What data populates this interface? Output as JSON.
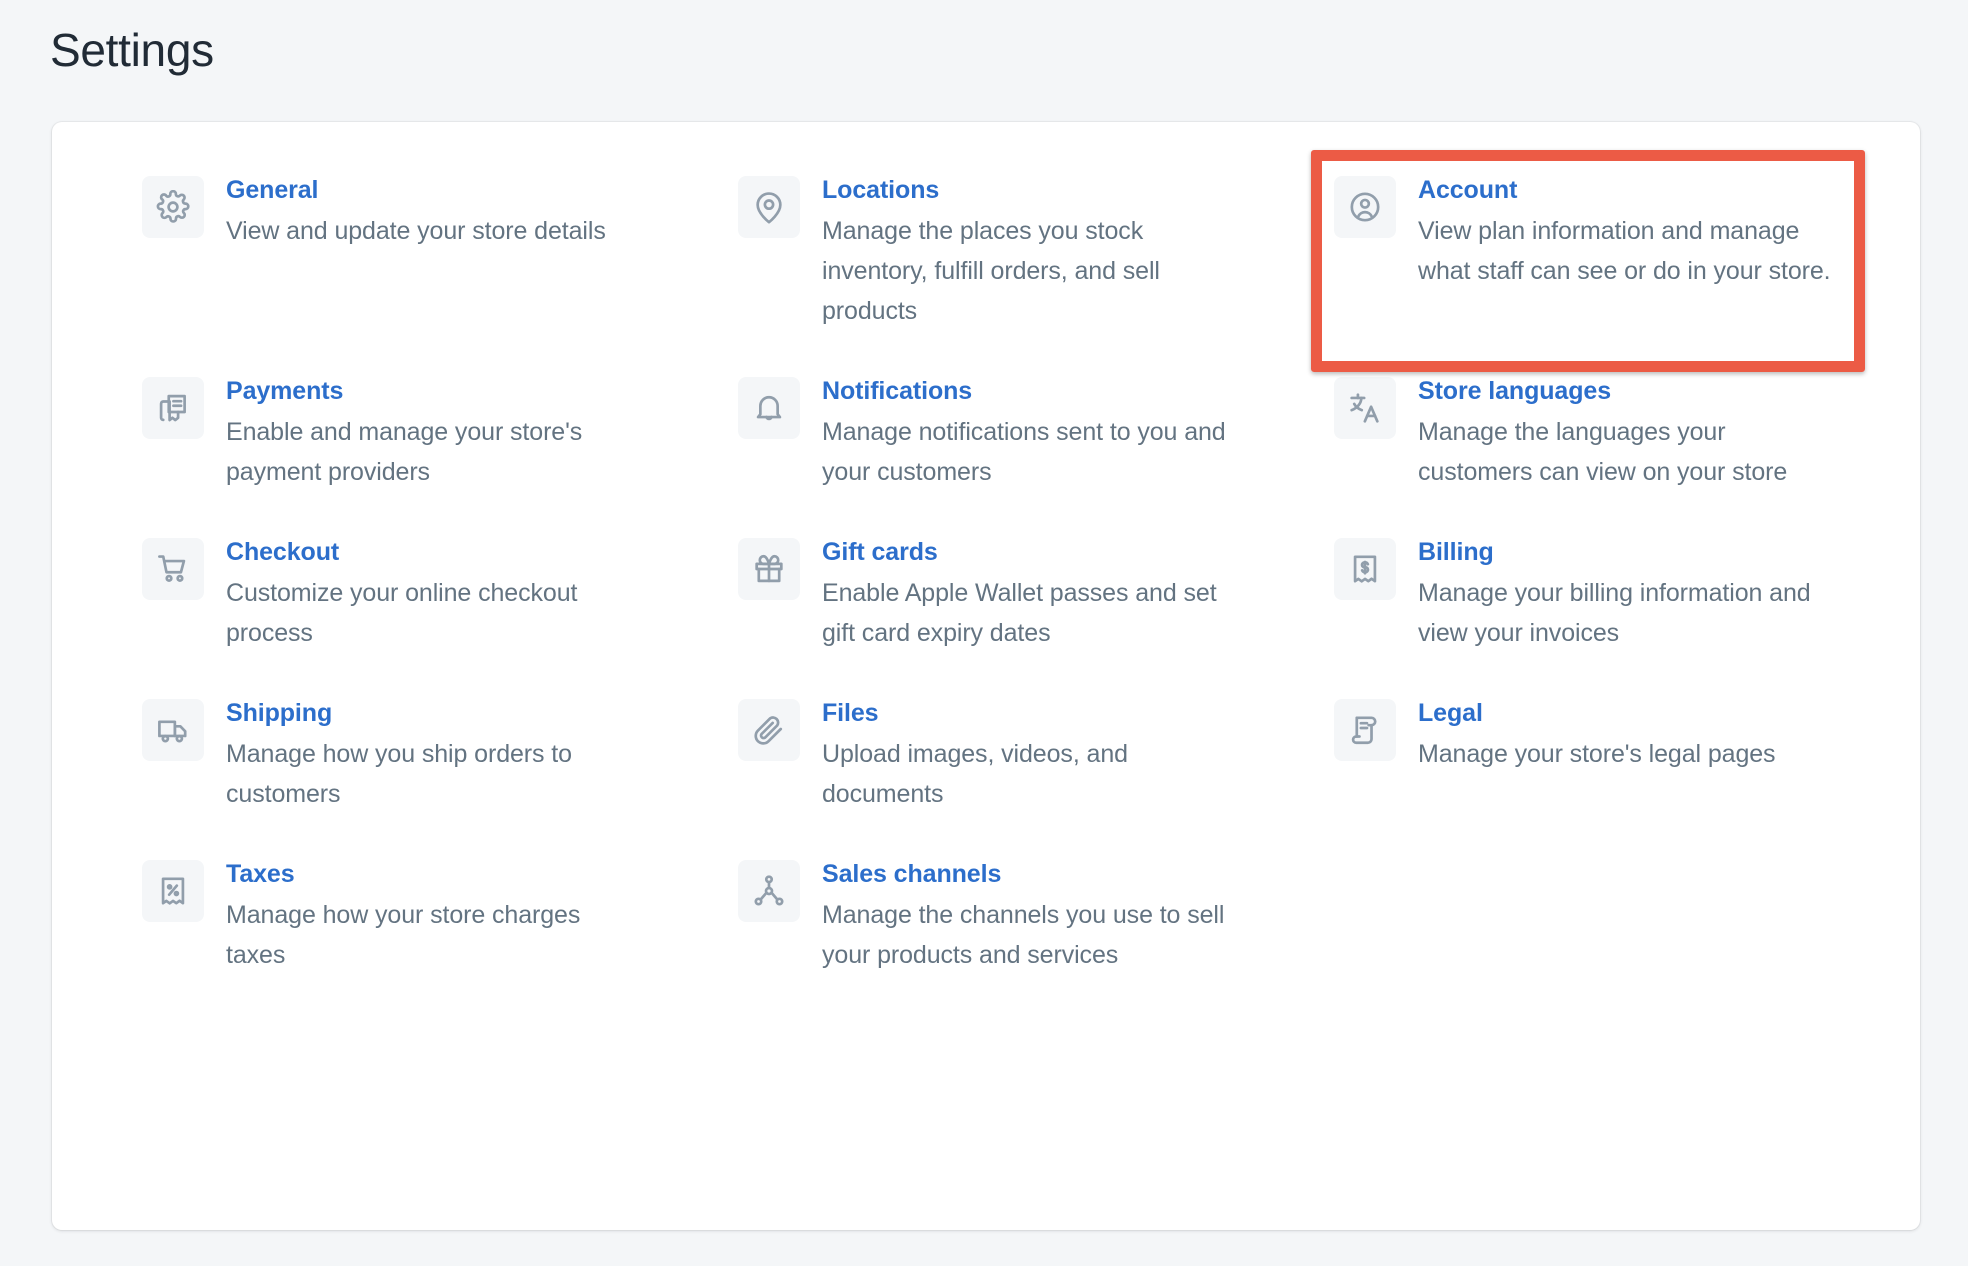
{
  "header": {
    "title": "Settings"
  },
  "colors": {
    "page_background": "#f4f6f8",
    "card_background": "#ffffff",
    "title_text": "#212b36",
    "link_blue": "#2c6ecb",
    "body_gray": "#637381",
    "icon_gray": "#919eab",
    "icon_tile": "#f4f6f8",
    "highlight_red": "#ec5b45"
  },
  "settings": {
    "items": [
      {
        "icon": "gear-icon",
        "title": "General",
        "description": "View and update your store details"
      },
      {
        "icon": "location-pin-icon",
        "title": "Locations",
        "description": "Manage the places you stock inventory, fulfill orders, and sell products"
      },
      {
        "icon": "account-avatar-icon",
        "title": "Account",
        "description": "View plan information and manage what staff can see or do in your store."
      },
      {
        "icon": "payments-cards-icon",
        "title": "Payments",
        "description": "Enable and manage your store's payment providers"
      },
      {
        "icon": "bell-icon",
        "title": "Notifications",
        "description": "Manage notifications sent to you and your customers"
      },
      {
        "icon": "translate-icon",
        "title": "Store languages",
        "description": "Manage the languages your customers can view on your store"
      },
      {
        "icon": "shopping-cart-icon",
        "title": "Checkout",
        "description": "Customize your online checkout process"
      },
      {
        "icon": "gift-box-icon",
        "title": "Gift cards",
        "description": "Enable Apple Wallet passes and set gift card expiry dates"
      },
      {
        "icon": "receipt-dollar-icon",
        "title": "Billing",
        "description": "Manage your billing information and view your invoices"
      },
      {
        "icon": "delivery-truck-icon",
        "title": "Shipping",
        "description": "Manage how you ship orders to customers"
      },
      {
        "icon": "paperclip-icon",
        "title": "Files",
        "description": "Upload images, videos, and documents"
      },
      {
        "icon": "legal-scroll-icon",
        "title": "Legal",
        "description": "Manage your store's legal pages"
      },
      {
        "icon": "receipt-percent-icon",
        "title": "Taxes",
        "description": "Manage how your store charges taxes"
      },
      {
        "icon": "sales-channels-network-icon",
        "title": "Sales channels",
        "description": "Manage the channels you use to sell your products and services"
      }
    ]
  },
  "annotation": {
    "highlighted_item": "Account"
  }
}
